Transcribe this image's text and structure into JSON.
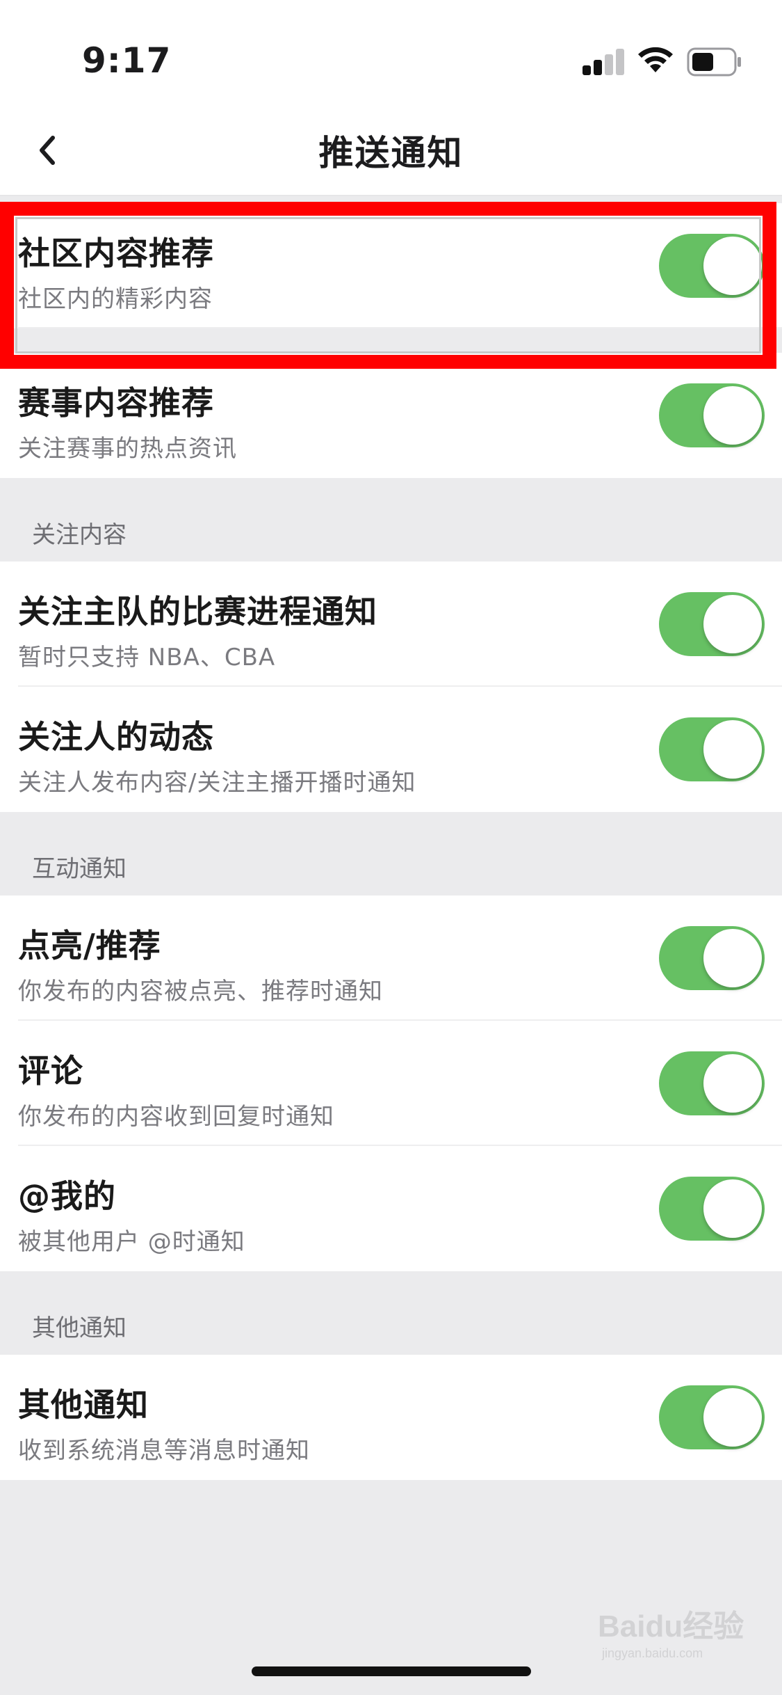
{
  "status_bar": {
    "time": "9:17"
  },
  "nav": {
    "title": "推送通知",
    "back_icon": "chevron-left-icon"
  },
  "rows_top": [
    {
      "title": "社区内容推荐",
      "subtitle": "社区内的精彩内容",
      "enabled": true
    },
    {
      "title": "赛事内容推荐",
      "subtitle": "关注赛事的热点资讯",
      "enabled": true
    }
  ],
  "section_follow": {
    "header": "关注内容",
    "rows": [
      {
        "title": "关注主队的比赛进程通知",
        "subtitle": "暂时只支持 NBA、CBA",
        "enabled": true
      },
      {
        "title": "关注人的动态",
        "subtitle": "关注人发布内容/关注主播开播时通知",
        "enabled": true
      }
    ]
  },
  "section_interact": {
    "header": "互动通知",
    "rows": [
      {
        "title": "点亮/推荐",
        "subtitle": "你发布的内容被点亮、推荐时通知",
        "enabled": true
      },
      {
        "title": "评论",
        "subtitle": "你发布的内容收到回复时通知",
        "enabled": true
      },
      {
        "title": "@我的",
        "subtitle": "被其他用户 @时通知",
        "enabled": true
      }
    ]
  },
  "section_other": {
    "header": "其他通知",
    "rows": [
      {
        "title": "其他通知",
        "subtitle": "收到系统消息等消息时通知",
        "enabled": true
      }
    ]
  },
  "watermark": {
    "text": "Baidu经验",
    "subtext": "jingyan.baidu.com"
  },
  "colors": {
    "toggle_on": "#66c063",
    "highlight": "#ff0000",
    "background": "#ebebed"
  }
}
